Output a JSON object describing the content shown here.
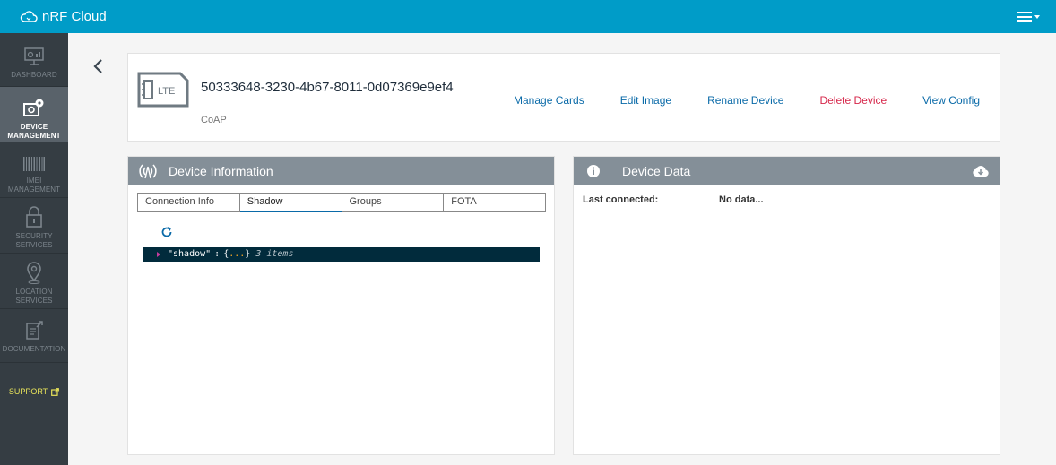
{
  "app": {
    "title": "nRF Cloud"
  },
  "sidebar": {
    "items": [
      {
        "label": "DASHBOARD",
        "icon": "dashboard-icon"
      },
      {
        "label": "DEVICE\nMANAGEMENT",
        "icon": "device-gear-icon"
      },
      {
        "label": "IMEI\nMANAGEMENT",
        "icon": "barcode-icon"
      },
      {
        "label": "SECURITY\nSERVICES",
        "icon": "lock-icon"
      },
      {
        "label": "LOCATION\nSERVICES",
        "icon": "location-pin-icon"
      },
      {
        "label": "DOCUMENTATION",
        "icon": "document-icon"
      }
    ],
    "support": "SUPPORT"
  },
  "device": {
    "badge": "LTE",
    "id": "50333648-3230-4b67-8011-0d07369e9ef4",
    "protocol": "CoAP",
    "actions": {
      "manage_cards": "Manage Cards",
      "edit_image": "Edit Image",
      "rename": "Rename Device",
      "delete": "Delete Device",
      "view_config": "View Config"
    }
  },
  "device_info": {
    "title": "Device Information",
    "tabs": [
      "Connection Info",
      "Shadow",
      "Groups",
      "FOTA"
    ],
    "active_tab": "Shadow",
    "json": {
      "key": "\"shadow\"",
      "colon": ":",
      "open": "{",
      "ellipsis": "...",
      "close": "}",
      "count": "3 items"
    }
  },
  "device_data": {
    "title": "Device Data",
    "last_connected_label": "Last connected:",
    "last_connected_value": "No data..."
  },
  "colors": {
    "topbar": "#009cc8",
    "sidebar": "#353d43",
    "link": "#0a6aa8",
    "danger": "#d6264a",
    "support": "#e8e35a"
  }
}
